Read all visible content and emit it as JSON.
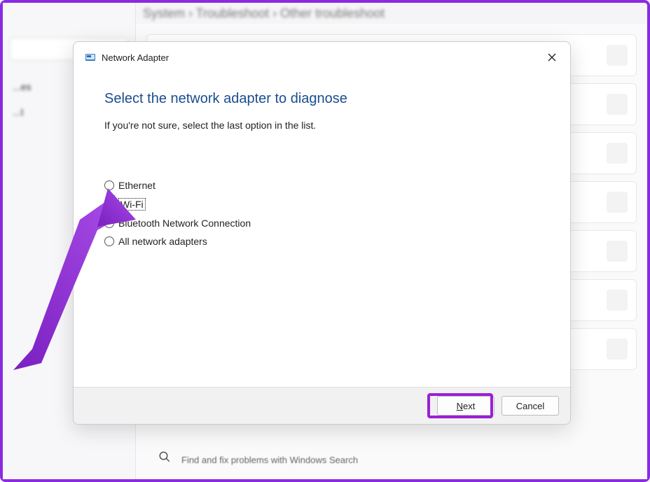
{
  "background": {
    "breadcrumb": "System   ›   Troubleshoot   ›   Other troubleshoot",
    "sidebar_items": [
      "...es",
      "...t"
    ],
    "bottom_help_text": "Find and fix problems with Windows Search"
  },
  "dialog": {
    "title": "Network Adapter",
    "heading": "Select the network adapter to diagnose",
    "subtext": "If you're not sure, select the last option in the list.",
    "options": [
      {
        "label": "Ethernet",
        "selected": false
      },
      {
        "label": "Wi-Fi",
        "selected": true
      },
      {
        "label": "Bluetooth Network Connection",
        "selected": false
      },
      {
        "label": "All network adapters",
        "selected": false
      }
    ],
    "next_label": "Next",
    "cancel_label": "Cancel"
  }
}
